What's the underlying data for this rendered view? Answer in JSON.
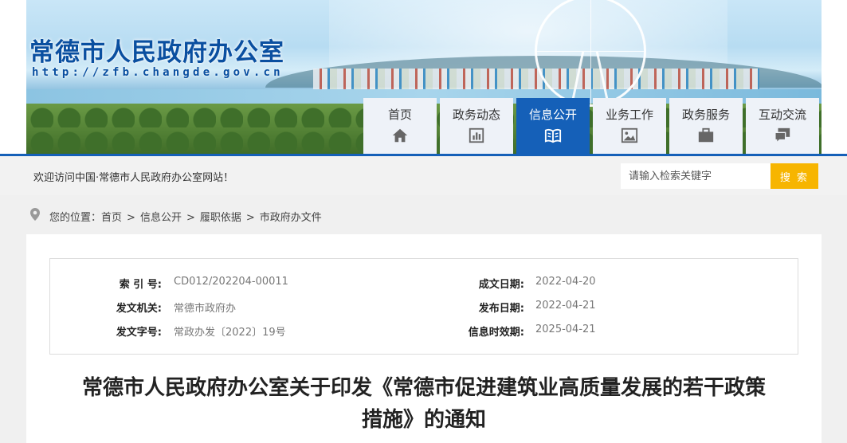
{
  "header": {
    "site_title": "常德市人民政府办公室",
    "site_url": "http://zfb.changde.gov.cn"
  },
  "nav": {
    "items": [
      {
        "label": "首页",
        "icon": "home-icon"
      },
      {
        "label": "政务动态",
        "icon": "chart-icon"
      },
      {
        "label": "信息公开",
        "icon": "book-icon",
        "active": true
      },
      {
        "label": "业务工作",
        "icon": "image-icon"
      },
      {
        "label": "政务服务",
        "icon": "briefcase-icon"
      },
      {
        "label": "互动交流",
        "icon": "chat-icon"
      }
    ]
  },
  "welcome": {
    "text": "欢迎访问中国·常德市人民政府办公室网站！"
  },
  "search": {
    "placeholder": "请输入检索关键字",
    "button_label": "搜 索"
  },
  "breadcrumb": {
    "prefix": "您的位置：",
    "items": [
      "首页",
      "信息公开",
      "履职依据",
      "市政府办文件"
    ],
    "separator": ">"
  },
  "meta": {
    "index_no_label": "索 引 号:",
    "index_no": "CD012/202204-00011",
    "created_date_label": "成文日期:",
    "created_date": "2022-04-20",
    "issuer_label": "发文机关:",
    "issuer": "常德市政府办",
    "published_date_label": "发布日期:",
    "published_date": "2022-04-21",
    "doc_no_label": "发文字号:",
    "doc_no": "常政办发〔2022〕19号",
    "valid_until_label": "信息时效期:",
    "valid_until": "2025-04-21"
  },
  "document": {
    "title_line1": "常德市人民政府办公室关于印发《常德市促进建筑业高质量发展的若干政策",
    "title_line2": "措施》的通知"
  },
  "colors": {
    "brand_blue": "#1560b8",
    "search_button": "#f7b500",
    "nav_inactive_bg": "#eef2f8"
  }
}
